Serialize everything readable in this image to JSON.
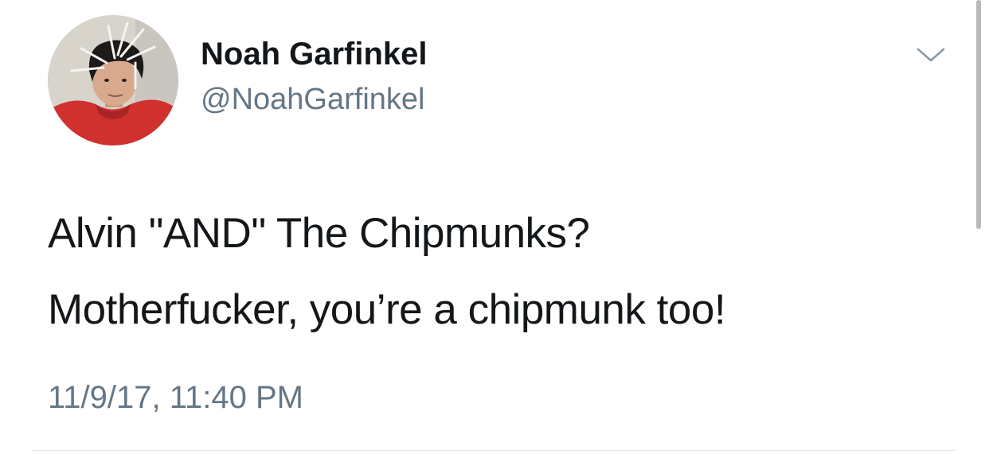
{
  "tweet": {
    "author": {
      "display_name": "Noah Garfinkel",
      "handle": "@NoahGarfinkel",
      "avatar_icon": "profile-photo"
    },
    "menu_icon": "chevron-down-icon",
    "text_lines": [
      "Alvin \"AND\" The Chipmunks?",
      "Motherfucker, you’re a chipmunk too!"
    ],
    "timestamp": "11/9/17, 11:40 PM"
  },
  "colors": {
    "name_text": "#14171a",
    "secondary_text": "#657786",
    "divider": "#e1e8ed",
    "hoodie_red": "#d0302e"
  }
}
